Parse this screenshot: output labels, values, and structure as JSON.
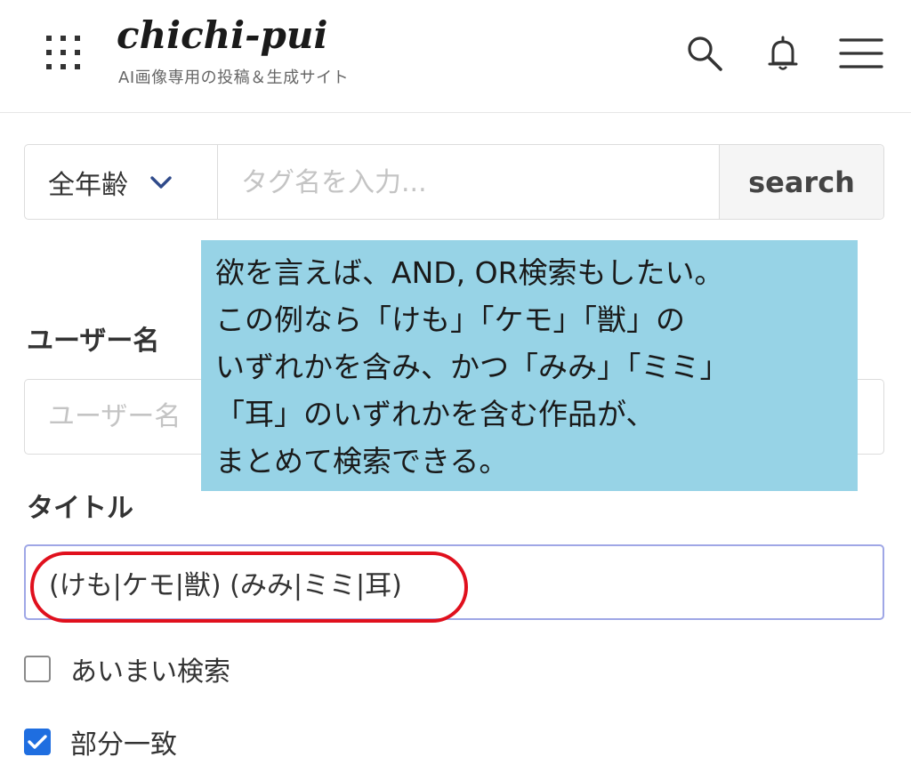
{
  "header": {
    "logo": "chichi-pui",
    "tagline": "AI画像専用の投稿＆生成サイト"
  },
  "search": {
    "age_filter": "全年齢",
    "placeholder": "タグ名を入力...",
    "button_label": "search"
  },
  "form": {
    "username_label": "ユーザー名",
    "username_placeholder": "ユーザー名",
    "title_label": "タイトル",
    "title_value": "(けも|ケモ|獣) (みみ|ミミ|耳)",
    "fuzzy_search_label": "あいまい検索",
    "fuzzy_search_checked": false,
    "partial_match_label": "部分一致",
    "partial_match_checked": true
  },
  "annotation": {
    "lines": [
      "欲を言えば、AND, OR検索もしたい。",
      "この例なら「けも」「ケモ」「獣」の",
      "いずれかを含み、かつ「みみ」「ミミ」",
      "「耳」のいずれかを含む作品が、",
      "まとめて検索できる。"
    ]
  },
  "colors": {
    "callout_bg": "#97d3e6",
    "highlight_oval": "#e0101d",
    "checkbox_checked": "#1f6ee0",
    "focused_input_border": "#9fa7e6"
  },
  "icons": [
    "grid-menu-icon",
    "search-icon",
    "bell-icon",
    "hamburger-menu-icon",
    "chevron-down-icon",
    "checkmark-icon"
  ]
}
